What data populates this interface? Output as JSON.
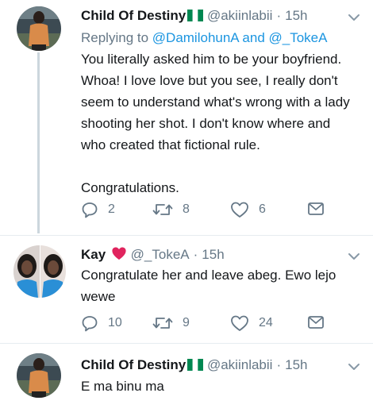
{
  "tweets": [
    {
      "name": "Child Of Destiny",
      "handle": "@akiinlabii",
      "dot": "·",
      "time": "15h",
      "reply_prefix": "Replying to ",
      "reply_mentions": "@DamilohunA and @_TokeA",
      "text": "You literally asked him to be your boyfriend.\nWhoa! I love love but you see, I really don't\nseem to understand what's wrong with a lady\nshooting her shot. I don't know where and\nwho created that fictional rule.\n\nCongratulations.",
      "replies": "2",
      "retweets": "8",
      "likes": "6",
      "flag_icon": "nigeria-flag-icon"
    },
    {
      "name": "Kay",
      "handle": "@_TokeA",
      "dot": "·",
      "time": "15h",
      "text": "Congratulate her and leave abeg. Ewo lejo\nwewe",
      "replies": "10",
      "retweets": "9",
      "likes": "24",
      "badge_icon": "heart-emoji-icon",
      "badge_color": "#e0245e"
    },
    {
      "name": "Child Of Destiny",
      "handle": "@akiinlabii",
      "dot": "·",
      "time": "15h",
      "text": "E ma binu ma",
      "flag_icon": "nigeria-flag-icon"
    }
  ],
  "colors": {
    "text": "#14171a",
    "secondary": "#657786",
    "link": "#1b95e0",
    "divider": "#e6ecf0",
    "thread_line": "#ccd6dd",
    "flag_green": "#008751"
  }
}
